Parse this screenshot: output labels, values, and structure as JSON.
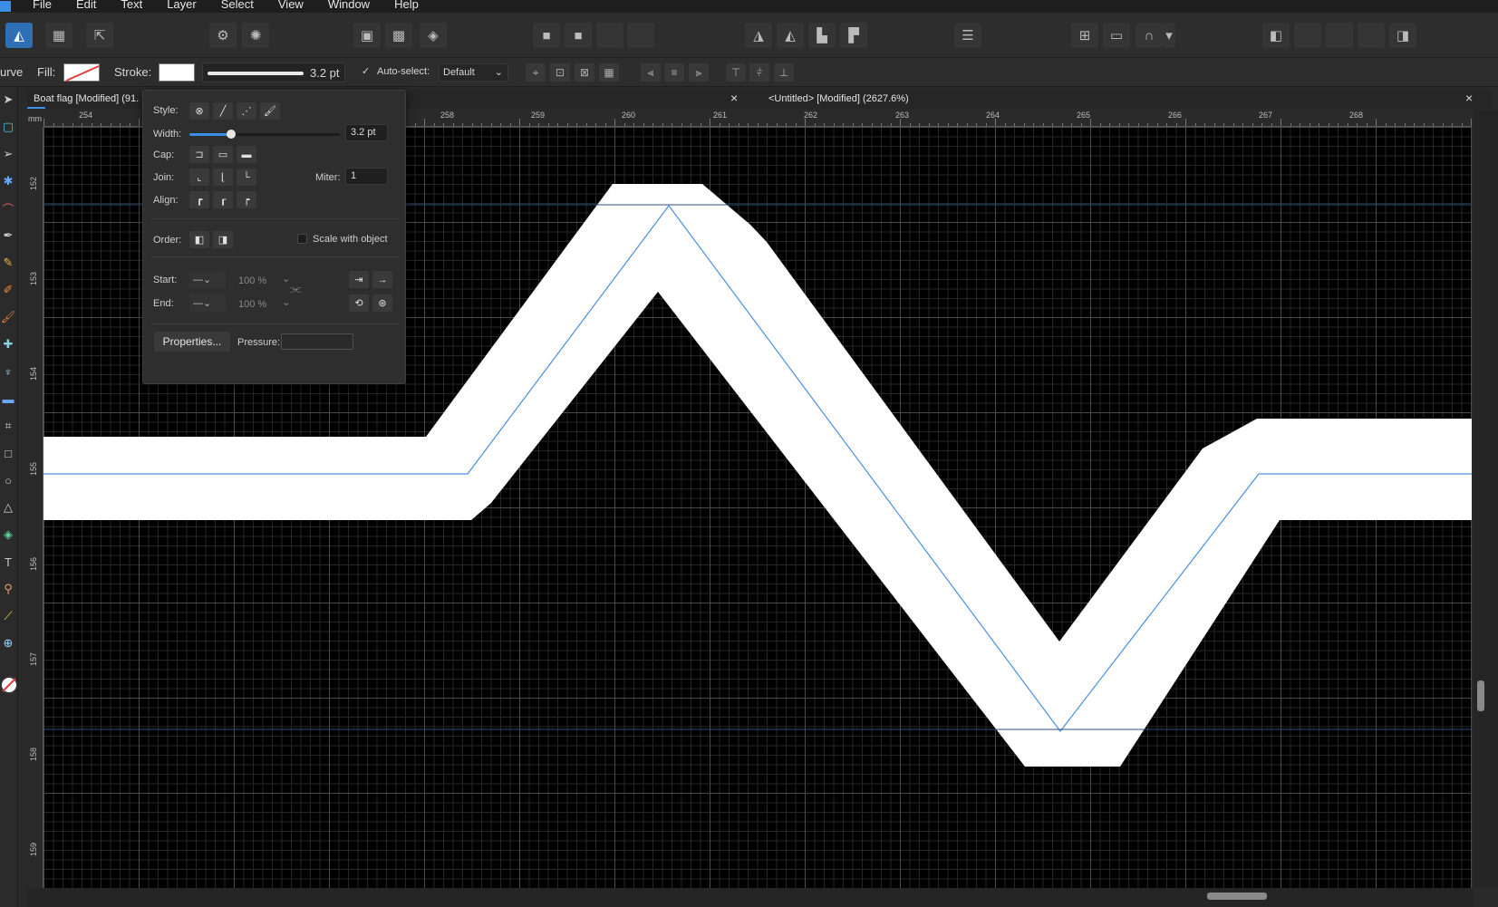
{
  "menu": [
    "File",
    "Edit",
    "Text",
    "Layer",
    "Select",
    "View",
    "Window",
    "Help"
  ],
  "context": {
    "tool_name": "urve",
    "fill_label": "Fill:",
    "stroke_label": "Stroke:",
    "stroke_width": "3.2 pt",
    "autoselect_label": "Auto-select:",
    "autoselect_value": "Default"
  },
  "tabs": [
    {
      "label": "Boat flag [Modified] (91."
    },
    {
      "label": "<Untitled> [Modified] (2627.6%)"
    }
  ],
  "ruler": {
    "unit": "mm",
    "top_labels": [
      "254",
      "258",
      "259",
      "260",
      "261",
      "262",
      "263",
      "264",
      "265",
      "266",
      "267",
      "268"
    ],
    "left_labels": [
      "152",
      "153",
      "154",
      "155",
      "156",
      "157",
      "158",
      "159"
    ]
  },
  "stroke_panel": {
    "style_label": "Style:",
    "width_label": "Width:",
    "width_value": "3.2 pt",
    "width_fraction": 0.28,
    "cap_label": "Cap:",
    "join_label": "Join:",
    "miter_label": "Miter:",
    "miter_value": "1",
    "align_label": "Align:",
    "order_label": "Order:",
    "scale_label": "Scale with object",
    "start_label": "Start:",
    "end_label": "End:",
    "start_percent": "100 %",
    "end_percent": "100 %",
    "properties_button": "Properties...",
    "pressure_label": "Pressure:"
  },
  "colors": {
    "accent": "#2f6fb3",
    "path_guide": "#4a90e2",
    "canvas_bg": "#000000",
    "stroke_fill": "#ffffff"
  }
}
